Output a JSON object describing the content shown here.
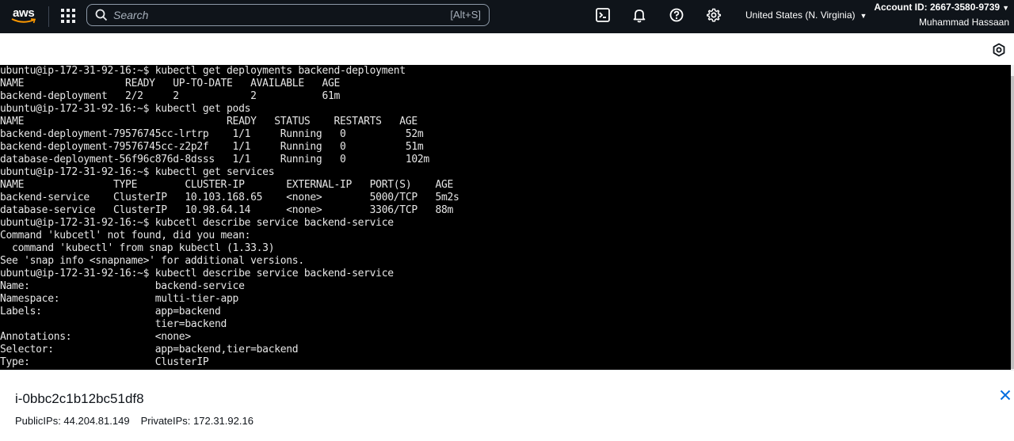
{
  "topbar": {
    "logo_text": "aws",
    "search": {
      "placeholder": "Search",
      "shortcut": "[Alt+S]"
    },
    "icons": [
      "cloudshell-icon",
      "bell-icon",
      "help-icon",
      "settings-gear-icon"
    ],
    "region": "United States (N. Virginia)",
    "account_id": "Account ID: 2667-3580-9739",
    "user": "Muhammad Hassaan"
  },
  "terminal": {
    "text": "ubuntu@ip-172-31-92-16:~$ kubectl get deployments backend-deployment\nNAME                 READY   UP-TO-DATE   AVAILABLE   AGE\nbackend-deployment   2/2     2            2           61m\nubuntu@ip-172-31-92-16:~$ kubectl get pods\nNAME                                  READY   STATUS    RESTARTS   AGE\nbackend-deployment-79576745cc-lrtrp    1/1     Running   0          52m\nbackend-deployment-79576745cc-z2p2f    1/1     Running   0          51m\ndatabase-deployment-56f96c876d-8dsss   1/1     Running   0          102m\nubuntu@ip-172-31-92-16:~$ kubectl get services\nNAME               TYPE        CLUSTER-IP       EXTERNAL-IP   PORT(S)    AGE\nbackend-service    ClusterIP   10.103.168.65    <none>        5000/TCP   5m2s\ndatabase-service   ClusterIP   10.98.64.14      <none>        3306/TCP   88m\nubuntu@ip-172-31-92-16:~$ kubcetl describe service backend-service\nCommand 'kubcetl' not found, did you mean:\n  command 'kubectl' from snap kubectl (1.33.3)\nSee 'snap info <snapname>' for additional versions.\nubuntu@ip-172-31-92-16:~$ kubectl describe service backend-service\nName:                     backend-service\nNamespace:                multi-tier-app\nLabels:                   app=backend\n                          tier=backend\nAnnotations:              <none>\nSelector:                 app=backend,tier=backend\nType:                     ClusterIP"
  },
  "instance": {
    "id": "i-0bbc2c1b12bc51df8",
    "public_ips": "PublicIPs: 44.204.81.149",
    "private_ips": "PrivateIPs: 172.31.92.16"
  },
  "colors": {
    "topbar_bg": "#0f141a",
    "terminal_bg": "#000000",
    "terminal_fg": "#e6e6e6",
    "close_icon": "#006ce0"
  }
}
